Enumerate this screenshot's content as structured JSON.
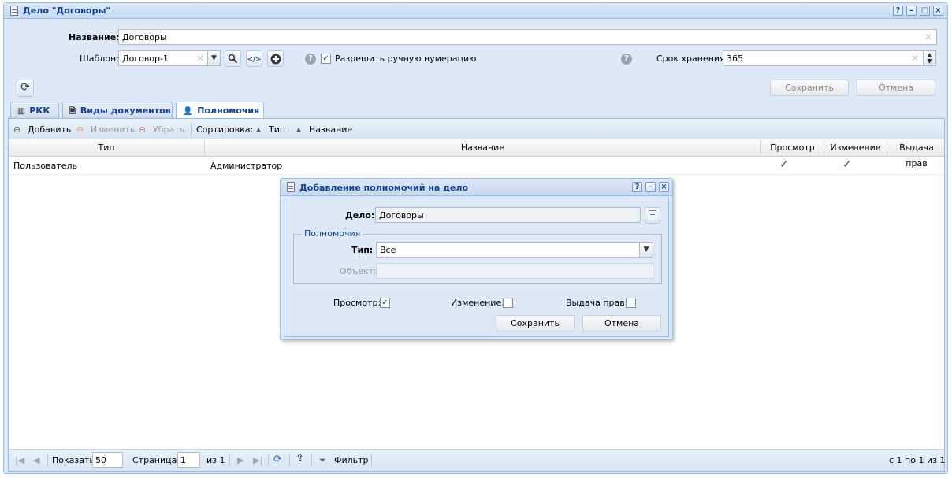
{
  "window": {
    "title": "Дело \"Договоры\"",
    "tools": [
      "?",
      "–",
      "□",
      "×"
    ]
  },
  "form": {
    "name_label": "Название:",
    "name_value": "Договоры",
    "template_label": "Шаблон:",
    "template_value": "Договор-1",
    "manual_numbering_label": "Разрешить ручную нумерацию",
    "manual_numbering_checked": true,
    "storage_label": "Срок хранения:",
    "storage_value": "365",
    "save_label": "Сохранить",
    "cancel_label": "Отмена"
  },
  "tabs": [
    {
      "label": "РКК",
      "icon": "barcode-icon"
    },
    {
      "label": "Виды документов",
      "icon": "document-settings-icon"
    },
    {
      "label": "Полномочия",
      "icon": "user-permissions-icon",
      "active": true
    }
  ],
  "toolbar": {
    "add": "Добавить",
    "edit": "Изменить",
    "remove": "Убрать",
    "sort_label": "Сортировка:",
    "sort_type": "Тип",
    "sort_name": "Название"
  },
  "grid": {
    "columns": [
      "Тип",
      "Название",
      "Просмотр",
      "Изменение",
      "Выдача прав"
    ],
    "rows": [
      {
        "type": "Пользователь",
        "name": "Администратор",
        "view": "✓",
        "edit": "✓",
        "grant": ""
      }
    ]
  },
  "pager": {
    "show_label": "Показать",
    "page_size": "50",
    "page_label": "Страница",
    "page": "1",
    "of_label": "из 1",
    "filter_label": "Фильтр",
    "summary": "с 1 по 1 из 1"
  },
  "dialog": {
    "title": "Добавление полномочий на дело",
    "case_label": "Дело:",
    "case_value": "Договоры",
    "fieldset_label": "Полномочия",
    "type_label": "Тип:",
    "type_value": "Все",
    "object_label": "Объект:",
    "view_label": "Просмотр:",
    "view_checked": true,
    "edit_label": "Изменение:",
    "edit_checked": false,
    "grant_label": "Выдача прав:",
    "grant_checked": false,
    "save_label": "Сохранить",
    "cancel_label": "Отмена"
  }
}
